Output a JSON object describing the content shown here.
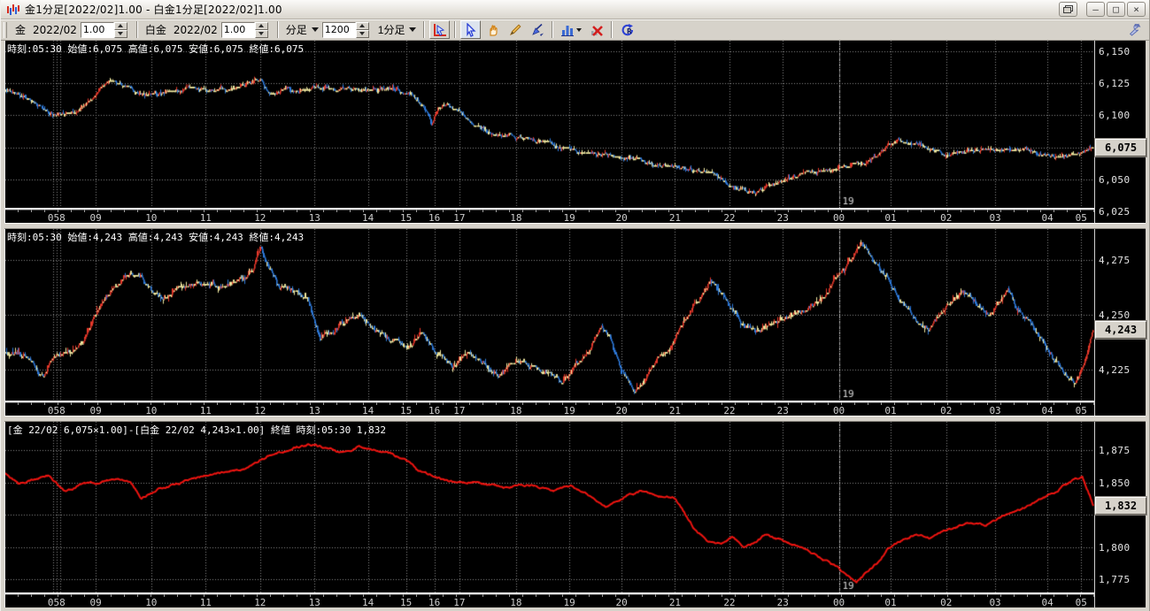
{
  "window": {
    "title": "金1分足[2022/02]1.00 - 白金1分足[2022/02]1.00",
    "buttons": {
      "minimize": "–",
      "maximize": "□",
      "close": "×"
    }
  },
  "toolbar": {
    "gold_label": "金",
    "gold_month": "2022/02",
    "gold_multiplier": "1.00",
    "platinum_label": "白金",
    "platinum_month": "2022/02",
    "platinum_multiplier": "1.00",
    "bar_type_label": "分足",
    "bar_count": "1200",
    "timeframe_label": "1分足",
    "icons": [
      "chart-cursor-icon",
      "select-arrow-icon",
      "hand-pan-icon",
      "pencil-icon",
      "pen-icon",
      "bar-chart-icon",
      "delete-drawing-icon",
      "reload-icon",
      "wrench-icon"
    ]
  },
  "colors": {
    "background": "#000000",
    "grid": "#8c8c8c",
    "candle_up": "#e8392b",
    "candle_down": "#2f7bdc",
    "candle_doji": "#efe8a0",
    "spread_line": "#ee1410",
    "chrome": "#d6d2ca",
    "price_box_bg": "#d6d2ca"
  },
  "x_axis": {
    "labels": [
      {
        "text": "058",
        "f": 0.047
      },
      {
        "text": "09",
        "f": 0.083
      },
      {
        "text": "10",
        "f": 0.134
      },
      {
        "text": "11",
        "f": 0.184
      },
      {
        "text": "12",
        "f": 0.234
      },
      {
        "text": "13",
        "f": 0.284
      },
      {
        "text": "14",
        "f": 0.333
      },
      {
        "text": "15",
        "f": 0.368
      },
      {
        "text": "16",
        "f": 0.394
      },
      {
        "text": "17",
        "f": 0.417
      },
      {
        "text": "18",
        "f": 0.469
      },
      {
        "text": "19",
        "f": 0.518
      },
      {
        "text": "20",
        "f": 0.566
      },
      {
        "text": "21",
        "f": 0.615
      },
      {
        "text": "22",
        "f": 0.665
      },
      {
        "text": "23",
        "f": 0.714
      },
      {
        "text": "00",
        "f": 0.7655
      },
      {
        "text": "01",
        "f": 0.813
      },
      {
        "text": "02",
        "f": 0.864
      },
      {
        "text": "03",
        "f": 0.909
      },
      {
        "text": "04",
        "f": 0.957
      },
      {
        "text": "05",
        "f": 0.988
      }
    ],
    "extra_grid_f": [
      0.0435,
      0.0505
    ],
    "date_line": {
      "text": "19",
      "f": 0.7655
    }
  },
  "chart_data": [
    {
      "type": "candlestick",
      "symbol": "金",
      "info": "時刻:05:30 始値:6,075 高値:6,075 安値:6,075 終値:6,075",
      "last_price": {
        "label": "6,075",
        "value": 6075
      },
      "ylim": [
        6028,
        6158
      ],
      "y_ticks": [
        {
          "v": 6150,
          "label": "6,150"
        },
        {
          "v": 6125,
          "label": "6,125"
        },
        {
          "v": 6100,
          "label": "6,100"
        },
        {
          "v": 6075,
          "label": ""
        },
        {
          "v": 6050,
          "label": "6,050"
        },
        {
          "v": 6025,
          "label": "6,025"
        }
      ],
      "bars": 1200,
      "anchors": [
        [
          0,
          6121
        ],
        [
          0.01,
          6117
        ],
        [
          0.028,
          6108
        ],
        [
          0.042,
          6101
        ],
        [
          0.055,
          6102
        ],
        [
          0.068,
          6103
        ],
        [
          0.078,
          6112
        ],
        [
          0.09,
          6123
        ],
        [
          0.1,
          6127
        ],
        [
          0.115,
          6120
        ],
        [
          0.13,
          6116
        ],
        [
          0.15,
          6119
        ],
        [
          0.17,
          6121
        ],
        [
          0.19,
          6119
        ],
        [
          0.21,
          6122
        ],
        [
          0.228,
          6126
        ],
        [
          0.234,
          6129
        ],
        [
          0.24,
          6119
        ],
        [
          0.248,
          6115
        ],
        [
          0.258,
          6121
        ],
        [
          0.27,
          6119
        ],
        [
          0.285,
          6122
        ],
        [
          0.3,
          6120
        ],
        [
          0.33,
          6121
        ],
        [
          0.36,
          6120
        ],
        [
          0.372,
          6117
        ],
        [
          0.385,
          6105
        ],
        [
          0.392,
          6094
        ],
        [
          0.398,
          6106
        ],
        [
          0.406,
          6109
        ],
        [
          0.416,
          6102
        ],
        [
          0.426,
          6096
        ],
        [
          0.436,
          6090
        ],
        [
          0.448,
          6087
        ],
        [
          0.458,
          6085
        ],
        [
          0.472,
          6083
        ],
        [
          0.49,
          6080
        ],
        [
          0.505,
          6076
        ],
        [
          0.52,
          6073
        ],
        [
          0.54,
          6070
        ],
        [
          0.56,
          6068
        ],
        [
          0.58,
          6065
        ],
        [
          0.6,
          6062
        ],
        [
          0.62,
          6058
        ],
        [
          0.64,
          6056
        ],
        [
          0.655,
          6052
        ],
        [
          0.665,
          6046
        ],
        [
          0.678,
          6042
        ],
        [
          0.69,
          6040
        ],
        [
          0.7,
          6044
        ],
        [
          0.715,
          6049
        ],
        [
          0.73,
          6053
        ],
        [
          0.75,
          6057
        ],
        [
          0.77,
          6060
        ],
        [
          0.79,
          6063
        ],
        [
          0.8,
          6068
        ],
        [
          0.812,
          6077
        ],
        [
          0.82,
          6081
        ],
        [
          0.83,
          6078
        ],
        [
          0.842,
          6075
        ],
        [
          0.857,
          6072
        ],
        [
          0.872,
          6070
        ],
        [
          0.887,
          6072
        ],
        [
          0.9,
          6074
        ],
        [
          0.915,
          6072
        ],
        [
          0.93,
          6074
        ],
        [
          0.945,
          6071
        ],
        [
          0.96,
          6069
        ],
        [
          0.972,
          6067
        ],
        [
          0.985,
          6070
        ],
        [
          1,
          6075
        ]
      ]
    },
    {
      "type": "candlestick",
      "symbol": "白金",
      "info": "時刻:05:30 始値:4,243 高値:4,243 安値:4,243 終値:4,243",
      "last_price": {
        "label": "4,243",
        "value": 4243
      },
      "ylim": [
        4211,
        4289
      ],
      "y_ticks": [
        {
          "v": 4275,
          "label": "4,275"
        },
        {
          "v": 4250,
          "label": "4,250"
        },
        {
          "v": 4225,
          "label": "4,225"
        }
      ],
      "bars": 1200,
      "anchors": [
        [
          0,
          4233
        ],
        [
          0.02,
          4231
        ],
        [
          0.034,
          4222
        ],
        [
          0.045,
          4231
        ],
        [
          0.06,
          4233
        ],
        [
          0.072,
          4238
        ],
        [
          0.082,
          4250
        ],
        [
          0.092,
          4259
        ],
        [
          0.105,
          4265
        ],
        [
          0.115,
          4269
        ],
        [
          0.125,
          4266
        ],
        [
          0.135,
          4260
        ],
        [
          0.145,
          4257
        ],
        [
          0.16,
          4263
        ],
        [
          0.18,
          4264
        ],
        [
          0.2,
          4263
        ],
        [
          0.218,
          4266
        ],
        [
          0.228,
          4271
        ],
        [
          0.234,
          4282
        ],
        [
          0.242,
          4272
        ],
        [
          0.252,
          4263
        ],
        [
          0.268,
          4261
        ],
        [
          0.28,
          4254
        ],
        [
          0.29,
          4239
        ],
        [
          0.302,
          4243
        ],
        [
          0.315,
          4247
        ],
        [
          0.327,
          4250
        ],
        [
          0.34,
          4244
        ],
        [
          0.355,
          4239
        ],
        [
          0.37,
          4235
        ],
        [
          0.383,
          4241
        ],
        [
          0.397,
          4233
        ],
        [
          0.41,
          4227
        ],
        [
          0.425,
          4233
        ],
        [
          0.44,
          4228
        ],
        [
          0.455,
          4222
        ],
        [
          0.47,
          4229
        ],
        [
          0.487,
          4226
        ],
        [
          0.5,
          4223
        ],
        [
          0.512,
          4220
        ],
        [
          0.525,
          4228
        ],
        [
          0.538,
          4236
        ],
        [
          0.548,
          4246
        ],
        [
          0.558,
          4238
        ],
        [
          0.568,
          4224
        ],
        [
          0.578,
          4215
        ],
        [
          0.59,
          4222
        ],
        [
          0.6,
          4230
        ],
        [
          0.612,
          4235
        ],
        [
          0.625,
          4248
        ],
        [
          0.638,
          4258
        ],
        [
          0.648,
          4267
        ],
        [
          0.658,
          4260
        ],
        [
          0.668,
          4252
        ],
        [
          0.68,
          4246
        ],
        [
          0.692,
          4243
        ],
        [
          0.705,
          4247
        ],
        [
          0.718,
          4249
        ],
        [
          0.73,
          4252
        ],
        [
          0.742,
          4255
        ],
        [
          0.752,
          4258
        ],
        [
          0.762,
          4266
        ],
        [
          0.775,
          4274
        ],
        [
          0.787,
          4284
        ],
        [
          0.795,
          4277
        ],
        [
          0.805,
          4270
        ],
        [
          0.815,
          4262
        ],
        [
          0.825,
          4254
        ],
        [
          0.838,
          4247
        ],
        [
          0.848,
          4243
        ],
        [
          0.858,
          4250
        ],
        [
          0.87,
          4256
        ],
        [
          0.882,
          4260
        ],
        [
          0.893,
          4255
        ],
        [
          0.905,
          4250
        ],
        [
          0.916,
          4258
        ],
        [
          0.922,
          4262
        ],
        [
          0.93,
          4253
        ],
        [
          0.94,
          4248
        ],
        [
          0.95,
          4240
        ],
        [
          0.962,
          4232
        ],
        [
          0.972,
          4224
        ],
        [
          0.982,
          4220
        ],
        [
          0.99,
          4226
        ],
        [
          1,
          4243
        ]
      ]
    },
    {
      "type": "line",
      "symbol": "spread",
      "info": "[金 22/02 6,075×1.00]-[白金 22/02 4,243×1.00] 終値 時刻:05:30 1,832",
      "last_price": {
        "label": "1,832",
        "value": 1832
      },
      "ylim": [
        1765,
        1897
      ],
      "y_ticks": [
        {
          "v": 1875,
          "label": "1,875"
        },
        {
          "v": 1850,
          "label": "1,850"
        },
        {
          "v": 1825,
          "label": ""
        },
        {
          "v": 1800,
          "label": "1,800"
        },
        {
          "v": 1775,
          "label": "1,775"
        }
      ],
      "bars": 1200,
      "anchors": [
        [
          0,
          1857
        ],
        [
          0.012,
          1848
        ],
        [
          0.025,
          1852
        ],
        [
          0.04,
          1855
        ],
        [
          0.055,
          1843
        ],
        [
          0.07,
          1848
        ],
        [
          0.085,
          1850
        ],
        [
          0.1,
          1853
        ],
        [
          0.115,
          1851
        ],
        [
          0.125,
          1838
        ],
        [
          0.135,
          1843
        ],
        [
          0.15,
          1848
        ],
        [
          0.165,
          1851
        ],
        [
          0.18,
          1854
        ],
        [
          0.195,
          1857
        ],
        [
          0.21,
          1859
        ],
        [
          0.225,
          1862
        ],
        [
          0.235,
          1868
        ],
        [
          0.25,
          1873
        ],
        [
          0.265,
          1877
        ],
        [
          0.28,
          1880
        ],
        [
          0.295,
          1877
        ],
        [
          0.31,
          1874
        ],
        [
          0.325,
          1878
        ],
        [
          0.34,
          1875
        ],
        [
          0.355,
          1872
        ],
        [
          0.37,
          1867
        ],
        [
          0.378,
          1860
        ],
        [
          0.39,
          1856
        ],
        [
          0.4,
          1853
        ],
        [
          0.415,
          1849
        ],
        [
          0.43,
          1851
        ],
        [
          0.445,
          1848
        ],
        [
          0.46,
          1846
        ],
        [
          0.475,
          1849
        ],
        [
          0.49,
          1847
        ],
        [
          0.505,
          1844
        ],
        [
          0.52,
          1847
        ],
        [
          0.53,
          1844
        ],
        [
          0.54,
          1838
        ],
        [
          0.552,
          1832
        ],
        [
          0.562,
          1835
        ],
        [
          0.572,
          1840
        ],
        [
          0.585,
          1843
        ],
        [
          0.6,
          1840
        ],
        [
          0.615,
          1838
        ],
        [
          0.625,
          1825
        ],
        [
          0.635,
          1812
        ],
        [
          0.645,
          1806
        ],
        [
          0.658,
          1803
        ],
        [
          0.668,
          1807
        ],
        [
          0.678,
          1800
        ],
        [
          0.69,
          1804
        ],
        [
          0.7,
          1810
        ],
        [
          0.712,
          1806
        ],
        [
          0.725,
          1802
        ],
        [
          0.74,
          1797
        ],
        [
          0.752,
          1790
        ],
        [
          0.762,
          1786
        ],
        [
          0.772,
          1779
        ],
        [
          0.782,
          1773
        ],
        [
          0.792,
          1780
        ],
        [
          0.802,
          1788
        ],
        [
          0.812,
          1800
        ],
        [
          0.825,
          1806
        ],
        [
          0.838,
          1810
        ],
        [
          0.85,
          1807
        ],
        [
          0.862,
          1812
        ],
        [
          0.875,
          1816
        ],
        [
          0.888,
          1820
        ],
        [
          0.9,
          1817
        ],
        [
          0.912,
          1822
        ],
        [
          0.925,
          1827
        ],
        [
          0.937,
          1831
        ],
        [
          0.95,
          1836
        ],
        [
          0.962,
          1842
        ],
        [
          0.972,
          1847
        ],
        [
          0.982,
          1852
        ],
        [
          0.99,
          1854
        ],
        [
          0.997,
          1840
        ],
        [
          1,
          1832
        ]
      ]
    }
  ]
}
